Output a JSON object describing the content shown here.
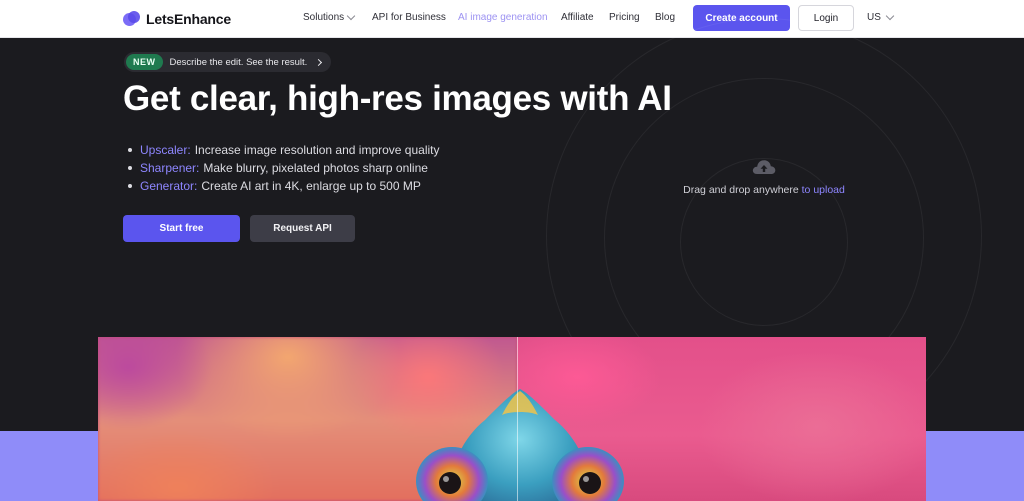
{
  "brand": {
    "name": "LetsEnhance"
  },
  "nav": {
    "links": [
      {
        "label": "Solutions",
        "has_dropdown": true
      },
      {
        "label": "API for Business"
      },
      {
        "label": "AI image generation",
        "active": true
      },
      {
        "label": "Affiliate"
      },
      {
        "label": "Pricing"
      },
      {
        "label": "Blog"
      }
    ],
    "create_account": "Create account",
    "login": "Login",
    "locale": "US"
  },
  "hero": {
    "badge_tag": "NEW",
    "badge_text": "Describe the edit. See the result.",
    "title": "Get clear, high-res images with AI",
    "features": [
      {
        "name": "Upscaler:",
        "text": "Increase image resolution and improve quality"
      },
      {
        "name": "Sharpener:",
        "text": "Make blurry, pixelated photos sharp online"
      },
      {
        "name": "Generator:",
        "text": "Create AI art in 4K, enlarge up to 500 MP"
      }
    ],
    "start_button": "Start free",
    "api_button": "Request API"
  },
  "upload": {
    "text": "Drag and drop anywhere",
    "link": "to upload",
    "icon": "cloud-upload-icon"
  },
  "colors": {
    "accent": "#5b55ee",
    "accent_text": "#8e86ff",
    "hero_bg": "#1b1b1f",
    "band": "#8f8cf9",
    "badge_green": "#1f7a4f"
  }
}
